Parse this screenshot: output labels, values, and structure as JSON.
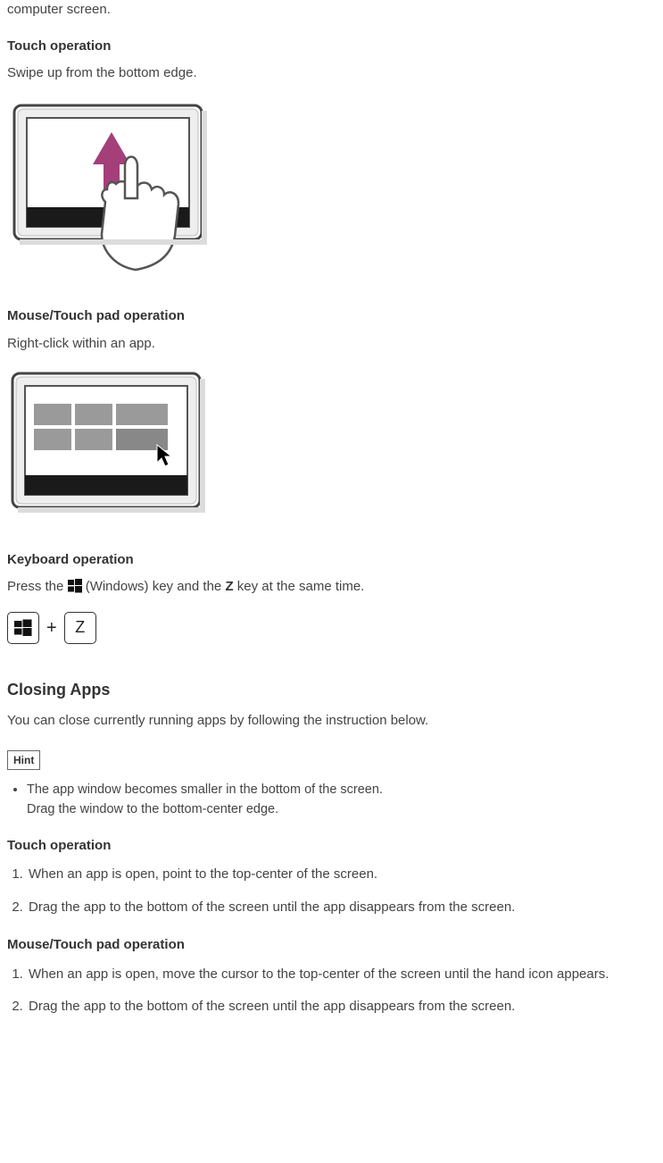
{
  "fragment_top": "computer screen.",
  "touch1": {
    "heading": "Touch operation",
    "text": "Swipe up from the bottom edge."
  },
  "mouse1": {
    "heading": "Mouse/Touch pad operation",
    "text": "Right-click within an app."
  },
  "keyboard1": {
    "heading": "Keyboard operation",
    "pre": "Press the ",
    "mid": " (Windows) key and the ",
    "key_letter": "Z",
    "post": " key at the same time.",
    "combo_key": "Z",
    "combo_plus": "+"
  },
  "closing": {
    "heading": "Closing Apps",
    "intro": "You can close currently running apps by following the instruction below.",
    "hint_label": "Hint",
    "hint_item_line1": "The app window becomes smaller in the bottom of the screen.",
    "hint_item_line2": "Drag the window to the bottom-center edge."
  },
  "touch2": {
    "heading": "Touch operation",
    "step1": "When an app is open, point to the top-center of the screen.",
    "step2": "Drag the app to the bottom of the screen until the app disappears from the screen."
  },
  "mouse2": {
    "heading": "Mouse/Touch pad operation",
    "step1": "When an app is open, move the cursor to the top-center of the screen until the hand icon appears.",
    "step2": "Drag the app to the bottom of the screen until the app disappears from the screen."
  }
}
